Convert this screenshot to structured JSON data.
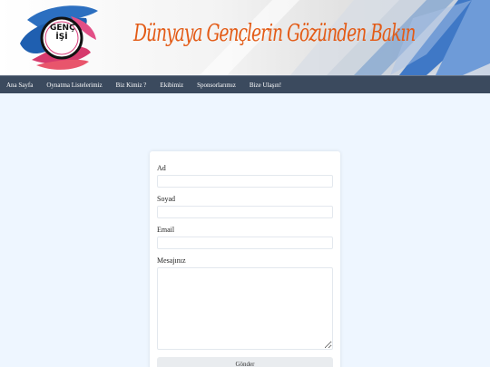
{
  "header": {
    "logo_line1": "GENÇ",
    "logo_line2": "İŞİ",
    "slogan": "Dünyaya Gençlerin Gözünden Bakın"
  },
  "nav": {
    "items": [
      "Ana Sayfa",
      "Oynatma Listelerimiz",
      "Biz Kimiz ?",
      "Ekibimiz",
      "Sponsorlarımız",
      "Bize Ulaşın!"
    ]
  },
  "form": {
    "name_label": "Ad",
    "surname_label": "Soyad",
    "email_label": "Email",
    "message_label": "Mesajınız",
    "name_value": "",
    "surname_value": "",
    "email_value": "",
    "message_value": "",
    "submit_label": "Gönder"
  },
  "colors": {
    "accent": "#e35b16",
    "nav_bg": "#3b4a5e",
    "page_bg": "#eef6ff"
  }
}
